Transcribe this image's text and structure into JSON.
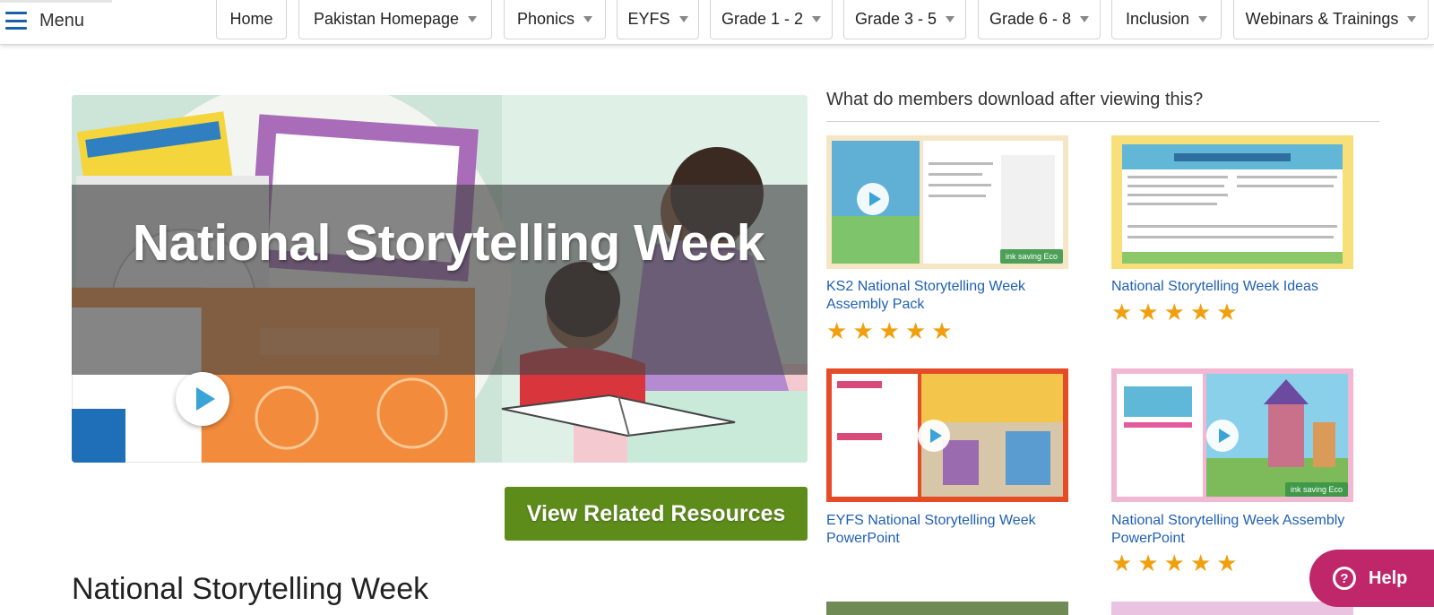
{
  "nav": {
    "menu_label": "Menu",
    "items": [
      {
        "label": "Home",
        "has_dropdown": false
      },
      {
        "label": "Pakistan Homepage",
        "has_dropdown": true
      },
      {
        "label": "Phonics",
        "has_dropdown": true
      },
      {
        "label": "EYFS",
        "has_dropdown": true
      },
      {
        "label": "Grade 1 - 2",
        "has_dropdown": true
      },
      {
        "label": "Grade 3 - 5",
        "has_dropdown": true
      },
      {
        "label": "Grade 6 - 8",
        "has_dropdown": true
      },
      {
        "label": "Inclusion",
        "has_dropdown": true
      },
      {
        "label": "Webinars & Trainings",
        "has_dropdown": true
      }
    ]
  },
  "hero": {
    "title": "National Storytelling Week",
    "play_icon": "play-icon"
  },
  "view_related_label": "View Related Resources",
  "page_heading": "National Storytelling Week",
  "related": {
    "heading": "What do members download after viewing this?",
    "cards": [
      {
        "title": "KS2 National Storytelling Week Assembly Pack",
        "rating": 5,
        "eco_badge": "ink saving Eco"
      },
      {
        "title": "National Storytelling Week Ideas",
        "rating": 5
      },
      {
        "title": "EYFS National Storytelling Week PowerPoint",
        "rating": 0
      },
      {
        "title": "National Storytelling Week Assembly PowerPoint",
        "rating": 5,
        "eco_badge": "ink saving Eco"
      }
    ]
  },
  "help_label": "Help",
  "colors": {
    "accent_blue": "#1b5fa8",
    "link_blue": "#1f5fb4",
    "view_button_green": "#5d8c1b",
    "star_gold": "#f0a00f",
    "help_pink": "#c0266a"
  }
}
